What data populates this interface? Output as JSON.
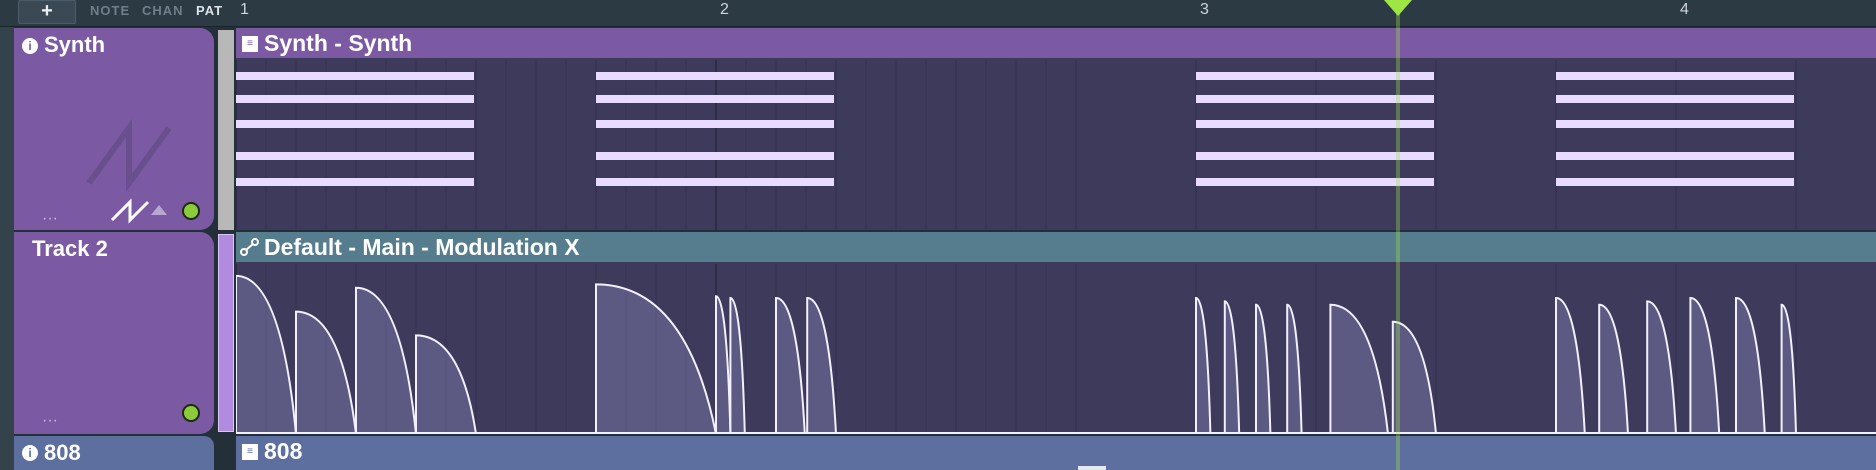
{
  "toolbar": {
    "add_label": "+",
    "modes": [
      {
        "label": "NOTE",
        "active": false
      },
      {
        "label": "CHAN",
        "active": false
      },
      {
        "label": "PAT",
        "active": true
      }
    ]
  },
  "ruler": {
    "bars": [
      "1",
      "2",
      "3",
      "4"
    ]
  },
  "tracks": [
    {
      "name": "Synth",
      "icon": "info-icon"
    },
    {
      "name": "Track 2",
      "icon": ""
    },
    {
      "name": "808",
      "icon": "info-icon"
    }
  ],
  "clips": {
    "synth": {
      "label": "Synth - Synth",
      "icon": "piano-roll-icon"
    },
    "automation": {
      "label": "Default - Main - Modulation X",
      "icon": "automation-icon"
    },
    "bass": {
      "label": "808",
      "icon": "piano-roll-icon"
    }
  },
  "playhead": {
    "position_bars": 3.42
  },
  "colors": {
    "purple_track": "#7b5aa3",
    "synth_header": "#7b5aa3",
    "auto_header": "#567d8d",
    "bass_header": "#5d6f9e",
    "grid_bg": "#3e3a5c",
    "note": "#e7dcff",
    "playhead": "#9ee644"
  },
  "synth_notes": [
    {
      "bar": 1.0,
      "len": 0.5,
      "row": 0
    },
    {
      "bar": 1.0,
      "len": 0.5,
      "row": 1
    },
    {
      "bar": 1.0,
      "len": 0.5,
      "row": 2
    },
    {
      "bar": 1.0,
      "len": 0.5,
      "row": 3
    },
    {
      "bar": 1.0,
      "len": 0.5,
      "row": 4
    },
    {
      "bar": 1.75,
      "len": 0.5,
      "row": 0
    },
    {
      "bar": 1.75,
      "len": 0.5,
      "row": 1
    },
    {
      "bar": 1.75,
      "len": 0.5,
      "row": 2
    },
    {
      "bar": 1.75,
      "len": 0.5,
      "row": 3
    },
    {
      "bar": 1.75,
      "len": 0.5,
      "row": 4
    },
    {
      "bar": 3.0,
      "len": 0.5,
      "row": 0
    },
    {
      "bar": 3.0,
      "len": 0.5,
      "row": 1
    },
    {
      "bar": 3.0,
      "len": 0.5,
      "row": 2
    },
    {
      "bar": 3.0,
      "len": 0.5,
      "row": 3
    },
    {
      "bar": 3.0,
      "len": 0.5,
      "row": 4
    },
    {
      "bar": 3.75,
      "len": 0.5,
      "row": 0
    },
    {
      "bar": 3.75,
      "len": 0.5,
      "row": 1
    },
    {
      "bar": 3.75,
      "len": 0.5,
      "row": 2
    },
    {
      "bar": 3.75,
      "len": 0.5,
      "row": 3
    },
    {
      "bar": 3.75,
      "len": 0.5,
      "row": 4
    }
  ],
  "automation_shapes": [
    {
      "bar": 1.0,
      "len": 0.125
    },
    {
      "bar": 1.125,
      "len": 0.125
    },
    {
      "bar": 1.25,
      "len": 0.125
    },
    {
      "bar": 1.375,
      "len": 0.125
    },
    {
      "bar": 1.75,
      "len": 0.25
    },
    {
      "bar": 2.0,
      "len": 0.03
    },
    {
      "bar": 2.03,
      "len": 0.03
    },
    {
      "bar": 2.125,
      "len": 0.06
    },
    {
      "bar": 2.19,
      "len": 0.06
    },
    {
      "bar": 3.0,
      "len": 0.03
    },
    {
      "bar": 3.06,
      "len": 0.03
    },
    {
      "bar": 3.125,
      "len": 0.03
    },
    {
      "bar": 3.19,
      "len": 0.03
    },
    {
      "bar": 3.28,
      "len": 0.12
    },
    {
      "bar": 3.41,
      "len": 0.09
    },
    {
      "bar": 3.75,
      "len": 0.06
    },
    {
      "bar": 3.84,
      "len": 0.06
    },
    {
      "bar": 3.94,
      "len": 0.06
    },
    {
      "bar": 4.03,
      "len": 0.06
    },
    {
      "bar": 4.125,
      "len": 0.06
    },
    {
      "bar": 4.22,
      "len": 0.03
    }
  ]
}
